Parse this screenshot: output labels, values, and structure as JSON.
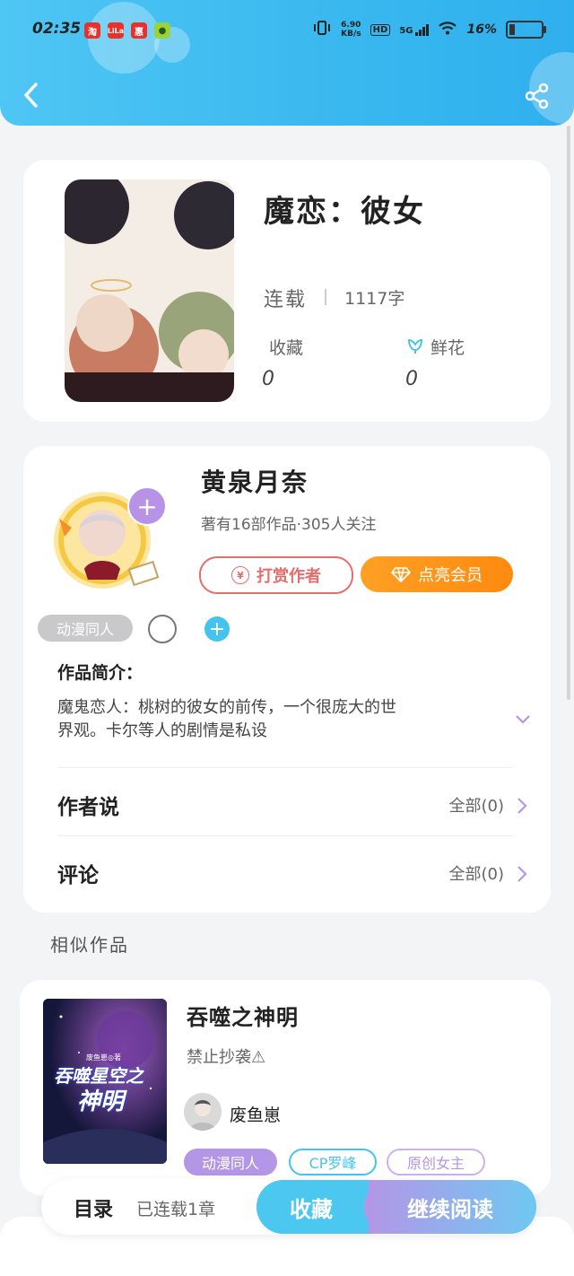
{
  "status_bar": {
    "time": "02:35",
    "net_speed_top": "6.90",
    "net_speed_bottom": "KB/s",
    "hd": "HD",
    "signal": "5G",
    "battery": "16%",
    "app_icons": [
      "淘",
      "LiLa",
      "惠",
      "●"
    ]
  },
  "book": {
    "title": "魔恋：彼女",
    "status": "连载",
    "word_count": "1117字",
    "favorites_label": "收藏",
    "favorites_value": "0",
    "flowers_label": "鲜花",
    "flowers_value": "0"
  },
  "author": {
    "name": "黄泉月奈",
    "stats": "著有16部作品·305人关注",
    "reward_label": "打赏作者",
    "vip_label": "点亮会员",
    "follow_plus": "+"
  },
  "category_tag": "动漫同人",
  "add_tag_plus": "+",
  "intro": {
    "heading": "作品简介：",
    "text_line1": "魔鬼恋人：桃树的彼女的前传，一个很庞大的世",
    "text_line2": "界观。卡尔等人的剧情是私设"
  },
  "author_says": {
    "label": "作者说",
    "action": "全部(0)"
  },
  "comments": {
    "label": "评论",
    "action": "全部(0)"
  },
  "similar": {
    "heading": "相似作品",
    "item": {
      "title": "吞噬之神明",
      "subtitle": "禁止抄袭⚠",
      "author": "废鱼崽",
      "cover_text_small": "废鱼崽◎著",
      "cover_text_line1": "吞噬星空之",
      "cover_text_line2": "神明",
      "tags": [
        "动漫同人",
        "CP罗峰",
        "原创女主"
      ]
    }
  },
  "bottom_bar": {
    "toc_label": "目录",
    "chapters": "已连载1章",
    "collect_label": "收藏",
    "continue_label": "继续阅读"
  },
  "colors": {
    "header": "#3bbaf0",
    "accent_blue": "#43c3ee",
    "accent_purple": "#b496e6",
    "vip_orange": "#ff9a1e",
    "reward_red": "#e86c6c"
  }
}
